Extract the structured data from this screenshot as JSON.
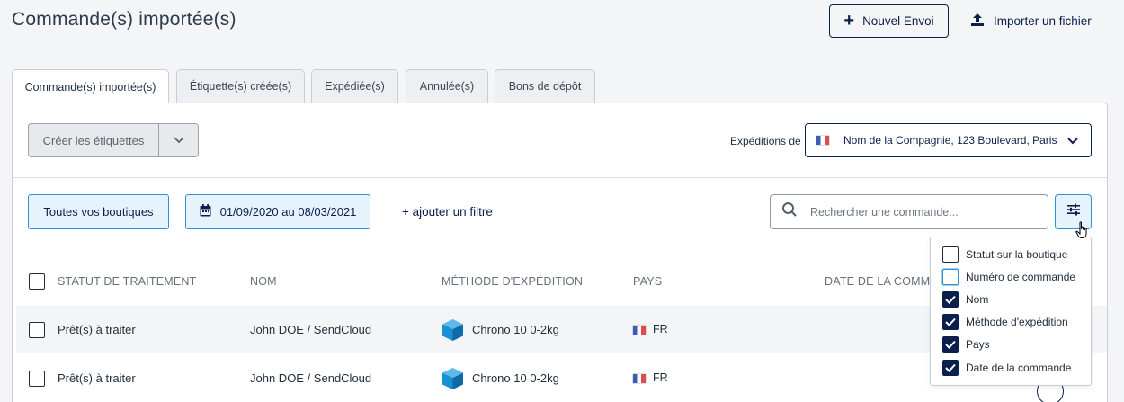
{
  "page": {
    "title": "Commande(s) importée(s)"
  },
  "header": {
    "new_send_label": "Nouvel Envoi",
    "import_label": "Importer un fichier"
  },
  "tabs": [
    {
      "label": "Commande(s) importée(s)",
      "active": true
    },
    {
      "label": "Étiquette(s) créée(s)",
      "active": false
    },
    {
      "label": "Expédiée(s)",
      "active": false
    },
    {
      "label": "Annulée(s)",
      "active": false
    },
    {
      "label": "Bons de dépôt",
      "active": false
    }
  ],
  "toolbar": {
    "create_labels": "Créer les étiquettes",
    "shipments_from_label": "Expéditions de",
    "shipments_from_value": "Nom de la Compagnie, 123 Boulevard, Paris"
  },
  "filters": {
    "shops": "Toutes vos boutiques",
    "date_range": "01/09/2020 au 08/03/2021",
    "add_filter": "+ ajouter un filtre",
    "search_placeholder": "Rechercher une commande..."
  },
  "table": {
    "columns": [
      "STATUT DE TRAITEMENT",
      "NOM",
      "MÉTHODE D'EXPÉDITION",
      "PAYS",
      "DATE DE LA COMMANDE"
    ],
    "rows": [
      {
        "status": "Prêt(s) à traiter",
        "name": "John DOE / SendCloud",
        "method": "Chrono 10 0-2kg",
        "country": "FR"
      },
      {
        "status": "Prêt(s) à traiter",
        "name": "John DOE / SendCloud",
        "method": "Chrono 10 0-2kg",
        "country": "FR"
      }
    ]
  },
  "column_menu": {
    "options": [
      {
        "label": "Statut sur la boutique",
        "checked": false
      },
      {
        "label": "Numéro de commande",
        "checked": false
      },
      {
        "label": "Nom",
        "checked": true
      },
      {
        "label": "Méthode d'expédition",
        "checked": true
      },
      {
        "label": "Pays",
        "checked": true
      },
      {
        "label": "Date de la commande",
        "checked": true
      }
    ]
  },
  "colors": {
    "primary": "#0b1f4d",
    "accent": "#2f8fd6",
    "pill_bg": "#e6f3fc",
    "box_blue": "#1a8fd1"
  }
}
